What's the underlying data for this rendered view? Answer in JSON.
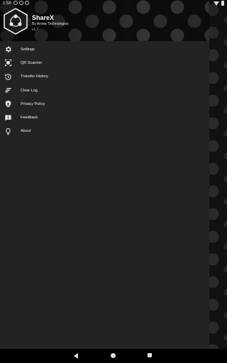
{
  "status_bar": {
    "time": "1:58"
  },
  "header": {
    "title": "ShareX",
    "subtitle": "By Aronic Technologies",
    "version": "v1.7"
  },
  "menu": [
    {
      "label": "Settings",
      "icon": "gear-icon"
    },
    {
      "label": "QR Scanner",
      "icon": "qr-scan-icon"
    },
    {
      "label": "Transfer History",
      "icon": "history-icon"
    },
    {
      "label": "Clear Log",
      "icon": "clear-icon"
    },
    {
      "label": "Privacy Policy",
      "icon": "shield-icon"
    },
    {
      "label": "Feedback",
      "icon": "feedback-icon"
    },
    {
      "label": "About",
      "icon": "lightbulb-icon"
    }
  ],
  "colors": {
    "drawer_bg": "#232323",
    "accent": "#2ecc71"
  }
}
